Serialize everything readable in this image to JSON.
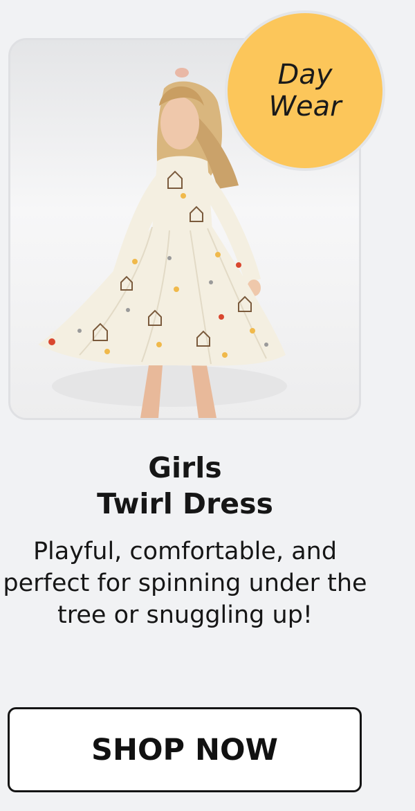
{
  "product": {
    "badge_line1": "Day",
    "badge_line2": "Wear",
    "title_line1": "Girls",
    "title_line2": "Twirl Dress",
    "description": "Playful, comfortable, and perfect for spinning under the tree or snuggling up!",
    "cta_label": "SHOP NOW",
    "image_subject": "girl-in-twirl-dress-photo"
  },
  "colors": {
    "page_background": "#f1f2f4",
    "badge_fill": "#fcc65a",
    "text": "#161616",
    "button_border": "#141414",
    "dress_fabric": "#f4efe1"
  }
}
